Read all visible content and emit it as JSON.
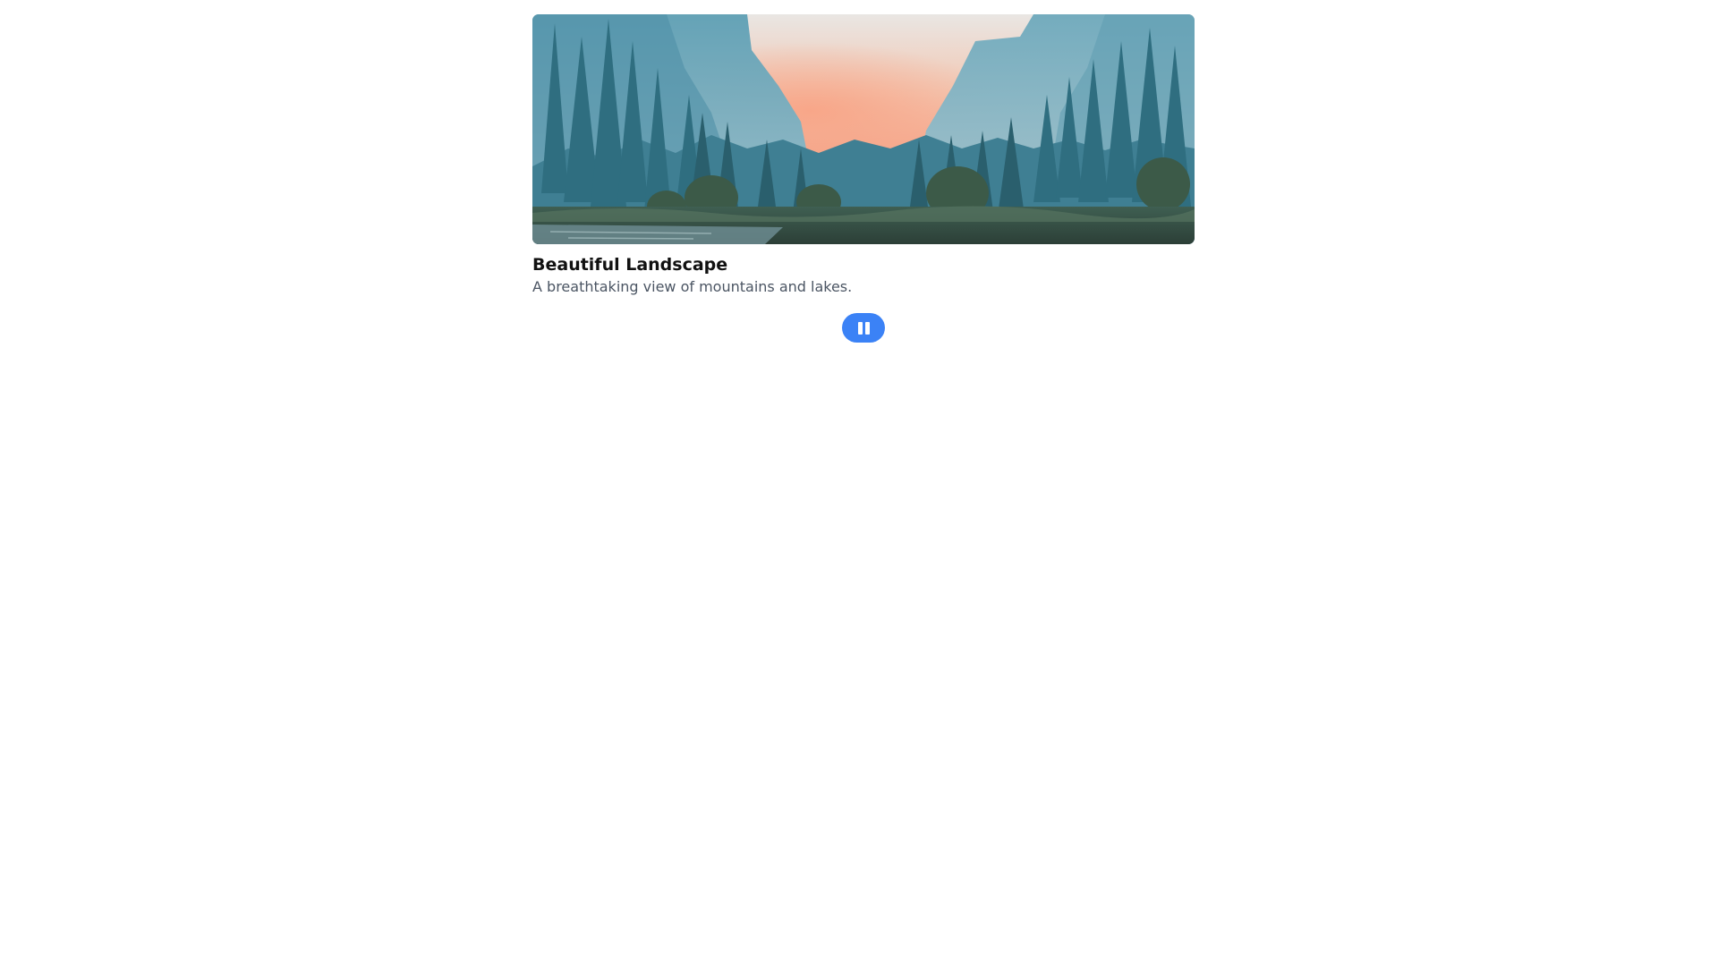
{
  "slide": {
    "title": "Beautiful Landscape",
    "description": "A breathtaking view of mountains and lakes.",
    "image_subject": "mountain valley with pine forest at sunrise"
  },
  "controls": {
    "pause_icon": "pause-icon"
  },
  "colors": {
    "accent": "#3b82f6",
    "title": "#111111",
    "description": "#4b5563"
  }
}
